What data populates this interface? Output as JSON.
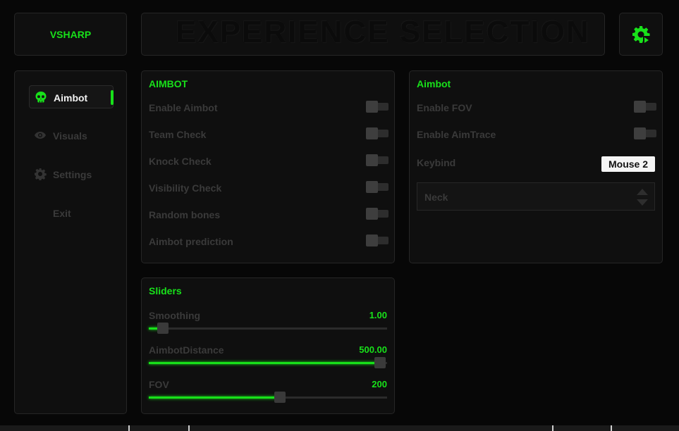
{
  "logo": {
    "text": "VSHARP"
  },
  "banner": {
    "text": "EXPERIENCE SELECTION"
  },
  "sidebar": {
    "items": [
      {
        "label": "Aimbot",
        "icon": "skull-icon",
        "active": true
      },
      {
        "label": "Visuals",
        "icon": "eye-icon",
        "active": false
      },
      {
        "label": "Settings",
        "icon": "gear-icon",
        "active": false
      },
      {
        "label": "Exit",
        "icon": "",
        "active": false
      }
    ]
  },
  "aimbot_left": {
    "title": "AIMBOT",
    "toggles": [
      {
        "label": "Enable Aimbot",
        "on": false
      },
      {
        "label": "Team Check",
        "on": false
      },
      {
        "label": "Knock Check",
        "on": false
      },
      {
        "label": "Visibility Check",
        "on": false
      },
      {
        "label": "Random bones",
        "on": false
      },
      {
        "label": "Aimbot prediction",
        "on": false
      }
    ]
  },
  "aimbot_right": {
    "title": "Aimbot",
    "toggles": [
      {
        "label": "Enable FOV",
        "on": false
      },
      {
        "label": "Enable AimTrace",
        "on": false
      }
    ],
    "keybind_label": "Keybind",
    "keybind_value": "Mouse 2",
    "bone_select": "Neck"
  },
  "sliders": {
    "title": "Sliders",
    "items": [
      {
        "label": "Smoothing",
        "value": "1.00",
        "fraction": 0.06
      },
      {
        "label": "AimbotDistance",
        "value": "500.00",
        "fraction": 0.97
      },
      {
        "label": "FOV",
        "value": "200",
        "fraction": 0.55
      }
    ]
  },
  "colors": {
    "accent": "#18e11a",
    "panel": "#0f0f0f",
    "border": "#262626"
  }
}
